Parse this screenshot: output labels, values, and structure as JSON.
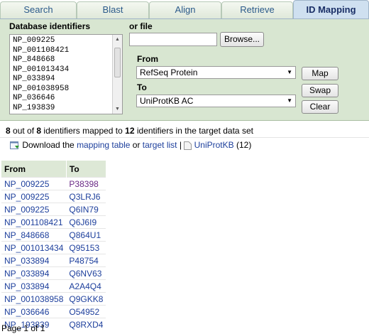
{
  "tabs": [
    {
      "label": "Search"
    },
    {
      "label": "Blast"
    },
    {
      "label": "Align"
    },
    {
      "label": "Retrieve"
    },
    {
      "label": "ID Mapping"
    }
  ],
  "form": {
    "ids_label": "Database identifiers",
    "ids": [
      "NP_009225",
      "NP_001108421",
      "NP_848668",
      "NP_001013434",
      "NP_033894",
      "NP_001038958",
      "NP_036646",
      "NP_193839"
    ],
    "file_label": "or file",
    "browse_label": "Browse...",
    "from_label": "From",
    "from_value": "RefSeq Protein",
    "to_label": "To",
    "to_value": "UniProtKB AC",
    "map_label": "Map",
    "swap_label": "Swap",
    "clear_label": "Clear"
  },
  "summary": {
    "mapped": "8",
    "t1": " out of ",
    "total": "8",
    "t2": " identifiers mapped to ",
    "targets": "12",
    "t3": " identifiers in the target data set"
  },
  "download": {
    "prefix": "Download the ",
    "mapping_link": "mapping table",
    "or": " or ",
    "target_link": "target list",
    "sep": " | ",
    "db_link": "UniProtKB",
    "count": " (12)"
  },
  "table": {
    "headers": [
      "From",
      "To"
    ],
    "rows": [
      [
        "NP_009225",
        "P38398"
      ],
      [
        "NP_009225",
        "Q3LRJ6"
      ],
      [
        "NP_009225",
        "Q6IN79"
      ],
      [
        "NP_001108421",
        "Q6J6I9"
      ],
      [
        "NP_848668",
        "Q864U1"
      ],
      [
        "NP_001013434",
        "Q95153"
      ],
      [
        "NP_033894",
        "P48754"
      ],
      [
        "NP_033894",
        "Q6NV63"
      ],
      [
        "NP_033894",
        "A2A4Q4"
      ],
      [
        "NP_001038958",
        "Q9GKK8"
      ],
      [
        "NP_036646",
        "O54952"
      ],
      [
        "NP_193839",
        "Q8RXD4"
      ]
    ]
  },
  "page_info": "Page 1 of 1",
  "colors": {
    "tab_bg": "#dfe8da",
    "active_tab": "#cfe0f0",
    "panel": "#d8e6d1",
    "link": "#1d3f9c",
    "visited": "#6a2a86"
  }
}
